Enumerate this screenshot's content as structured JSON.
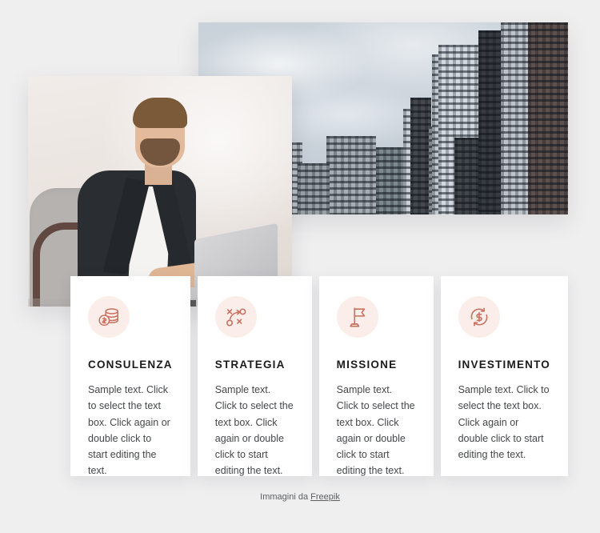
{
  "theme": {
    "background": "#efeff0",
    "card_background": "#ffffff",
    "icon_circle": "#fbeeea",
    "icon_stroke": "#c9705f",
    "title_color": "#1b1b1d",
    "body_color": "#45474a"
  },
  "media": {
    "city_photo": {
      "alt": "Cityscape of modern glass skyscrapers under a cloudy sky"
    },
    "person_photo": {
      "alt": "Bearded businessman in a dark blazer and white t-shirt working on a laptop"
    }
  },
  "cards": [
    {
      "icon": "coins-stack-dollar-icon",
      "title": "CONSULENZA",
      "body": "Sample text. Click to select the text box. Click again or double click to start editing the text."
    },
    {
      "icon": "strategy-playbook-icon",
      "title": "STRATEGIA",
      "body": "Sample text. Click to select the text box. Click again or double click to start editing the text."
    },
    {
      "icon": "flag-icon",
      "title": "MISSIONE",
      "body": "Sample text. Click to select the text box. Click again or double click to start editing the text."
    },
    {
      "icon": "dollar-refresh-icon",
      "title": "INVESTIMENTO",
      "body": "Sample text. Click to select the text box. Click again or double click to start editing the text."
    }
  ],
  "footer": {
    "prefix": "Immagini da ",
    "link_label": "Freepik"
  }
}
